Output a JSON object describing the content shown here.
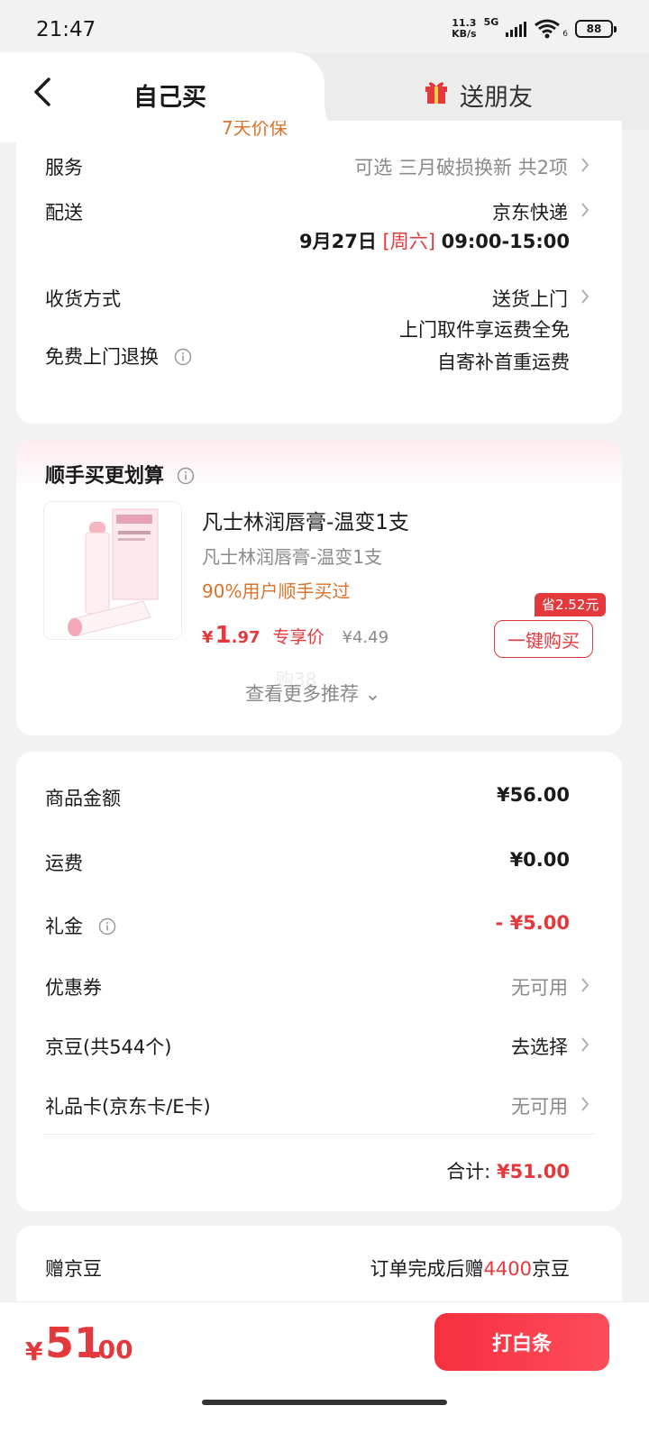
{
  "status_bar": {
    "time": "21:47",
    "net_speed_value": "11.3",
    "net_speed_unit": "KB/s",
    "network": "5G",
    "wifi_sub": "6",
    "battery": "88"
  },
  "tabs": {
    "self": "自己买",
    "friend": "送朋友"
  },
  "peek_text": "7天价保",
  "order": {
    "service": {
      "label": "服务",
      "value": "可选 三月破损换新 共2项"
    },
    "delivery": {
      "label": "配送",
      "carrier": "京东快递",
      "date": "9月27日",
      "weekday": "[周六]",
      "time": "09:00-15:00"
    },
    "receive": {
      "label": "收货方式",
      "value": "送货上门"
    },
    "return": {
      "label": "免费上门退换",
      "line1": "上门取件享运费全免",
      "line2": "自寄补首重运费"
    }
  },
  "addon": {
    "title": "顺手买更划算",
    "product_name": "凡士林润唇膏-温变1支",
    "product_sub": "凡士林润唇膏-温变1支",
    "tag": "90%用户顺手买过",
    "price_currency": "¥",
    "price_int": "1",
    "price_dec": ".97",
    "price_label": "专享价",
    "price_original": "¥4.49",
    "save_badge": "省2.52元",
    "buy_button": "一键购买",
    "watermark": "购38",
    "more": "查看更多推荐 ⌄"
  },
  "summary": {
    "goods": {
      "label": "商品金额",
      "value": "¥56.00"
    },
    "shipping": {
      "label": "运费",
      "value": "¥0.00"
    },
    "gift_cash": {
      "label": "礼金",
      "value": "- ¥5.00"
    },
    "coupon": {
      "label": "优惠券",
      "value": "无可用"
    },
    "jingdou": {
      "label": "京豆(共544个)",
      "value": "去选择"
    },
    "gift_card": {
      "label": "礼品卡(京东卡/E卡)",
      "value": "无可用"
    },
    "total_label": "合计:",
    "total_value": "¥51.00"
  },
  "bonus": {
    "label": "赠京豆",
    "prefix": "订单完成后赠",
    "amount": "4400",
    "suffix": "京豆"
  },
  "bottom": {
    "currency": "¥",
    "amount_int": "51",
    "amount_dec": ".00",
    "pay_button": "打白条"
  },
  "colors": {
    "accent": "#e4393c",
    "orange": "#d9732b"
  }
}
